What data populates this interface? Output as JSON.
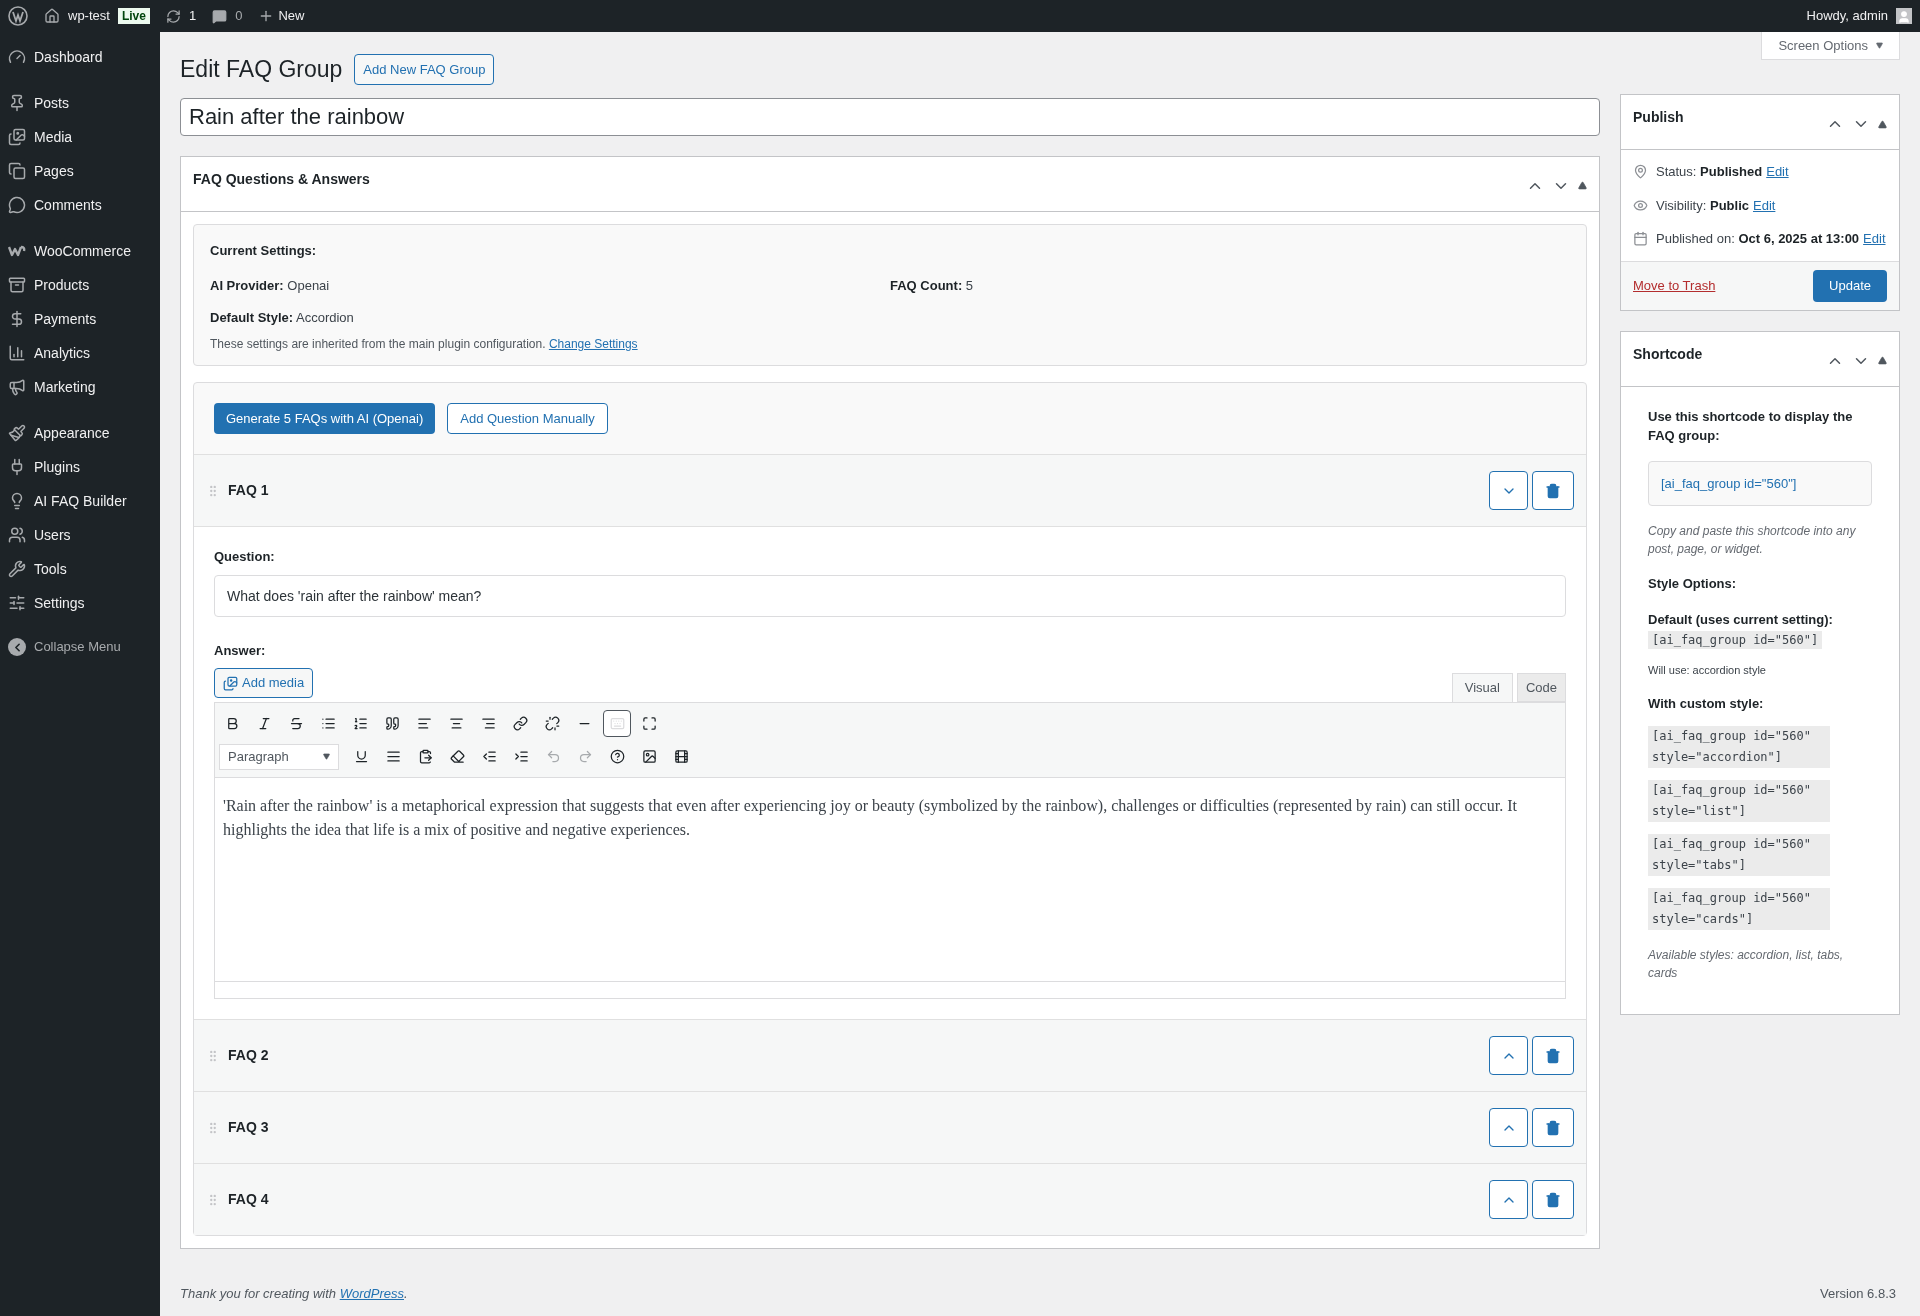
{
  "admin_bar": {
    "site": "wp-test",
    "badge": "Live",
    "updates": "1",
    "comments": "0",
    "new": "New",
    "greeting": "Howdy, admin"
  },
  "menu": [
    [
      {
        "label": "Dashboard"
      }
    ],
    [
      {
        "label": "Posts"
      },
      {
        "label": "Media"
      },
      {
        "label": "Pages"
      },
      {
        "label": "Comments"
      }
    ],
    [
      {
        "label": "WooCommerce"
      },
      {
        "label": "Products"
      },
      {
        "label": "Payments"
      },
      {
        "label": "Analytics"
      },
      {
        "label": "Marketing"
      }
    ],
    [
      {
        "label": "Appearance"
      },
      {
        "label": "Plugins"
      },
      {
        "label": "AI FAQ Builder"
      },
      {
        "label": "Users"
      },
      {
        "label": "Tools"
      },
      {
        "label": "Settings"
      }
    ]
  ],
  "collapse": "Collapse Menu",
  "screen_options": "Screen Options",
  "page_title": "Edit FAQ Group",
  "add_new": "Add New FAQ Group",
  "post_title": "Rain after the rainbow",
  "faq_box": {
    "title": "FAQ Questions & Answers",
    "settings": {
      "heading": "Current Settings:",
      "provider_label": "AI Provider:",
      "provider": "Openai",
      "count_label": "FAQ Count:",
      "count": "5",
      "style_label": "Default Style:",
      "style": "Accordion",
      "note": "These settings are inherited from the main plugin configuration.",
      "link": "Change Settings"
    },
    "generate": "Generate 5 FAQs with AI (Openai)",
    "add_manual": "Add Question Manually",
    "faqs": [
      {
        "title": "FAQ 1",
        "expanded": true,
        "question_label": "Question:",
        "question": "What does 'rain after the rainbow' mean?",
        "answer_label": "Answer:",
        "add_media": "Add media",
        "tabs": [
          {
            "label": "Visual",
            "selected": true
          },
          {
            "label": "Code",
            "selected": false
          }
        ],
        "format": "Paragraph",
        "toolbar_toggle_on": true,
        "answer": "'Rain after the rainbow' is a metaphorical expression that suggests that even after experiencing joy or beauty (symbolized by the rainbow), challenges or difficulties (represented by rain) can still occur. It highlights the idea that life is a mix of positive and negative experiences."
      },
      {
        "title": "FAQ 2",
        "expanded": false
      },
      {
        "title": "FAQ 3",
        "expanded": false
      },
      {
        "title": "FAQ 4",
        "expanded": false
      }
    ]
  },
  "publish": {
    "title": "Publish",
    "rows": [
      {
        "label": "Status:",
        "value": "Published",
        "link": "Edit"
      },
      {
        "label": "Visibility:",
        "value": "Public",
        "link": "Edit"
      },
      {
        "label": "Published on:",
        "value": "Oct 6, 2025 at 13:00",
        "link": "Edit"
      }
    ],
    "trash": "Move to Trash",
    "update": "Update"
  },
  "shortcode": {
    "title": "Shortcode",
    "intro": "Use this shortcode to display the FAQ group:",
    "code": "[ai_faq_group id=\"560\"]",
    "hint": "Copy and paste this shortcode into any post, page, or widget.",
    "style_heading": "Style Options:",
    "default_heading": "Default (uses current setting):",
    "default_code": "[ai_faq_group id=\"560\"]",
    "will_use": "Will use: accordion style",
    "custom_heading": "With custom style:",
    "custom_codes": [
      "[ai_faq_group id=\"560\" style=\"accordion\"]",
      "[ai_faq_group id=\"560\" style=\"list\"]",
      "[ai_faq_group id=\"560\" style=\"tabs\"]",
      "[ai_faq_group id=\"560\" style=\"cards\"]"
    ],
    "available": "Available styles: accordion, list, tabs, cards"
  },
  "footer": {
    "text": "Thank you for creating with",
    "link": "WordPress",
    "end": ".",
    "version": "Version 6.8.3"
  }
}
